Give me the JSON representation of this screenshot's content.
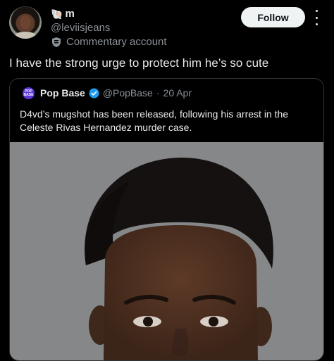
{
  "author": {
    "emoji": "🐚",
    "name": "m",
    "handle": "@leviisjeans",
    "badge_label": "Commentary account",
    "follow_label": "Follow"
  },
  "tweet": {
    "text": "I have the strong urge to protect him he’s so cute"
  },
  "quote": {
    "avatar_text": "POP BASE",
    "name": "Pop Base",
    "handle": "@PopBase",
    "separator": "·",
    "date": "20 Apr",
    "text_line1": "D4vd’s mugshot has been released, following his arrest in the",
    "text_line2": "Celeste Rivas Hernandez murder case."
  },
  "colors": {
    "background": "#000000",
    "text": "#e7e9ea",
    "muted": "#8b9198",
    "verified": "#1d9bf0",
    "border": "#2f3336"
  }
}
